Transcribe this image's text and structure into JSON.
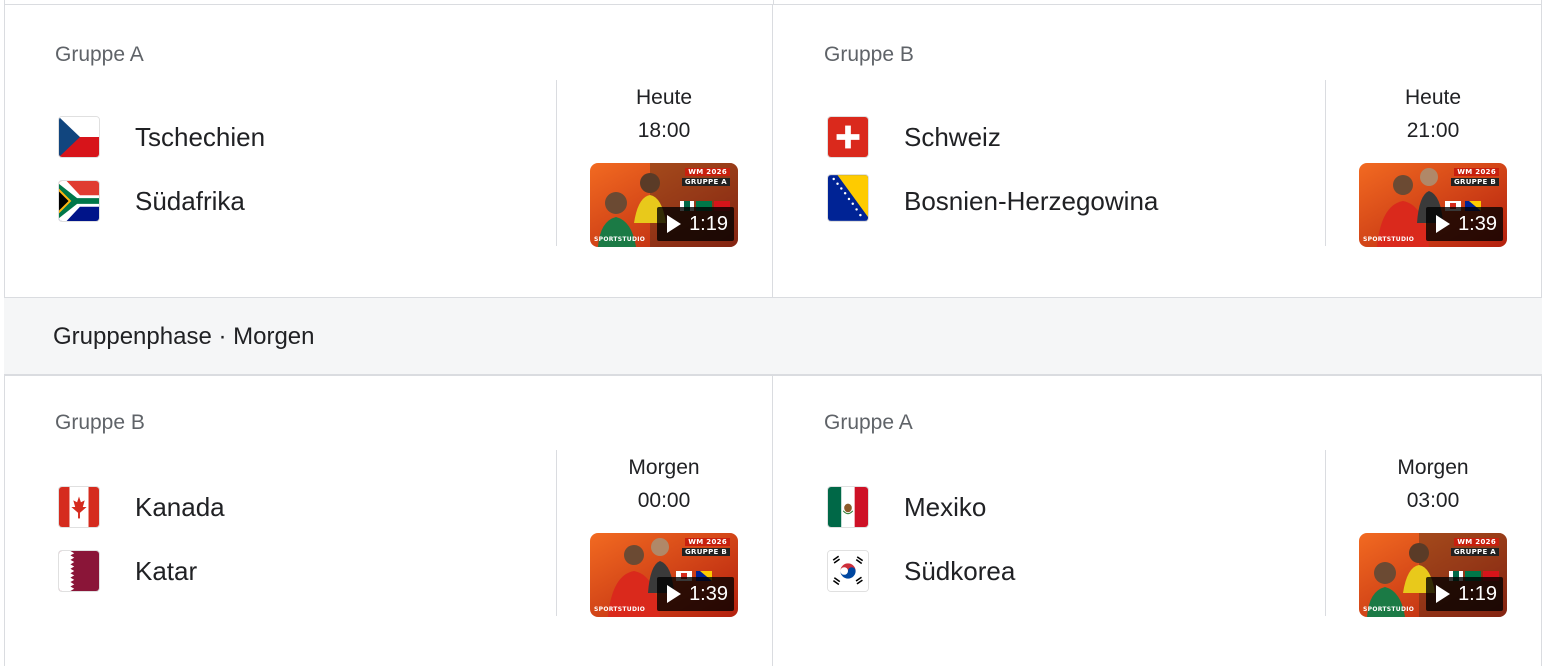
{
  "stage": {
    "title": "Gruppenphase · Morgen"
  },
  "rows": [
    {
      "matches": [
        {
          "group": "Gruppe A",
          "team1": {
            "name": "Tschechien",
            "flag": "czech-flag"
          },
          "team2": {
            "name": "Südafrika",
            "flag": "south-africa-flag"
          },
          "day": "Heute",
          "time": "18:00",
          "video": {
            "duration": "1:19",
            "badge_top": "WM 2026",
            "badge_group": "GRUPPE A",
            "brand": "SPORTSTUDIO"
          }
        },
        {
          "group": "Gruppe B",
          "team1": {
            "name": "Schweiz",
            "flag": "switzerland-flag"
          },
          "team2": {
            "name": "Bosnien-Herzegowina",
            "flag": "bosnia-flag"
          },
          "day": "Heute",
          "time": "21:00",
          "video": {
            "duration": "1:39",
            "badge_top": "WM 2026",
            "badge_group": "GRUPPE B",
            "brand": "SPORTSTUDIO"
          }
        }
      ]
    },
    {
      "matches": [
        {
          "group": "Gruppe B",
          "team1": {
            "name": "Kanada",
            "flag": "canada-flag"
          },
          "team2": {
            "name": "Katar",
            "flag": "qatar-flag"
          },
          "day": "Morgen",
          "time": "00:00",
          "video": {
            "duration": "1:39",
            "badge_top": "WM 2026",
            "badge_group": "GRUPPE B",
            "brand": "SPORTSTUDIO"
          }
        },
        {
          "group": "Gruppe A",
          "team1": {
            "name": "Mexiko",
            "flag": "mexico-flag"
          },
          "team2": {
            "name": "Südkorea",
            "flag": "south-korea-flag"
          },
          "day": "Morgen",
          "time": "03:00",
          "video": {
            "duration": "1:19",
            "badge_top": "WM 2026",
            "badge_group": "GRUPPE A",
            "brand": "SPORTSTUDIO"
          }
        }
      ]
    }
  ],
  "colors": {
    "border": "#dadce0",
    "stage_bg": "#f5f6f7",
    "group_text": "#5f6368",
    "text": "#202124",
    "thumb_orange": "#e8501c"
  }
}
